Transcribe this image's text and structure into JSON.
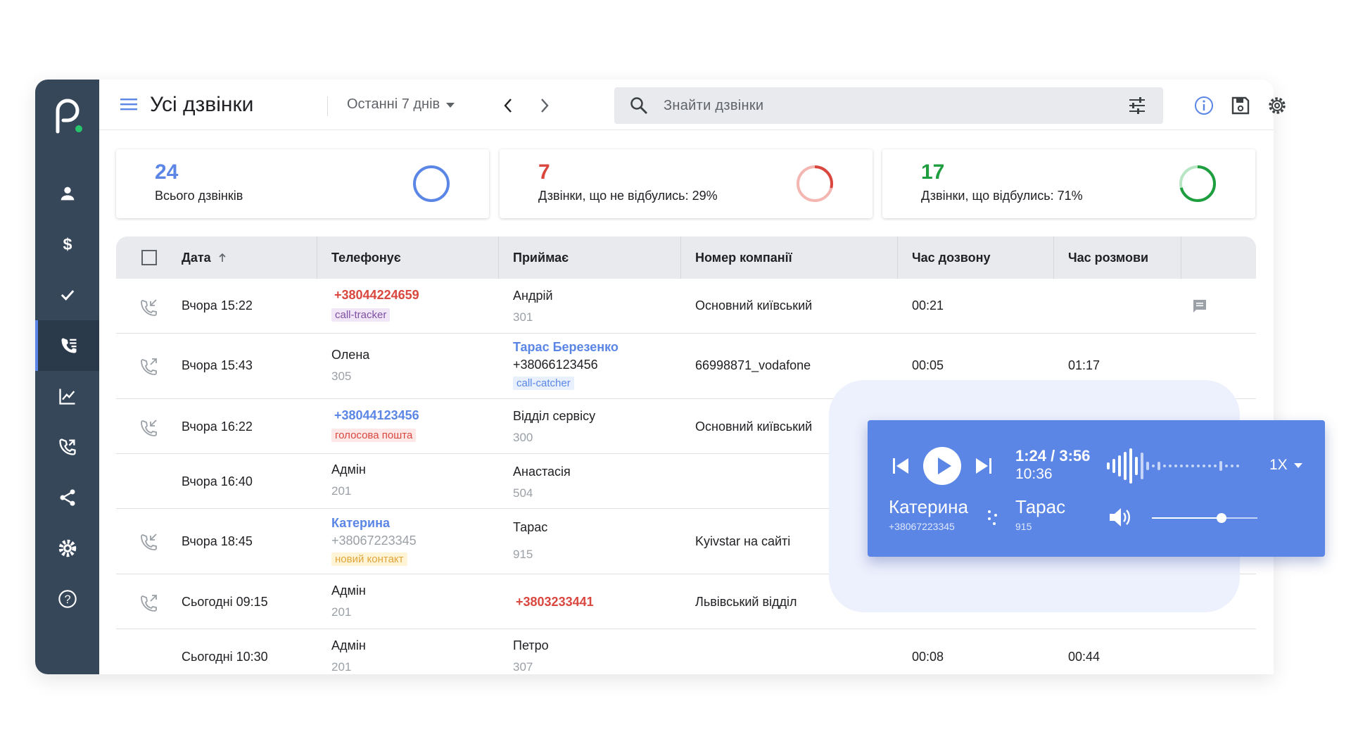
{
  "header": {
    "title": "Усі дзвінки",
    "period": "Останні 7 днів",
    "search_placeholder": "Знайти дзвінки"
  },
  "sidebar": {
    "items": [
      {
        "name": "users-icon"
      },
      {
        "name": "dollar-icon"
      },
      {
        "name": "check-icon"
      },
      {
        "name": "calls-list-icon",
        "active": true
      },
      {
        "name": "chart-icon"
      },
      {
        "name": "call-forward-icon"
      },
      {
        "name": "share-icon"
      },
      {
        "name": "settings-icon"
      },
      {
        "name": "help-icon"
      }
    ]
  },
  "stats": [
    {
      "value": "24",
      "label": "Всього дзвінків",
      "color": "#5b86e5",
      "ratio": 1.0
    },
    {
      "value": "7",
      "label": "Дзвінки, що не відбулись: 29%",
      "color": "#d9473e",
      "ratio": 0.29
    },
    {
      "value": "17",
      "label": "Дзвінки, що відбулись: 71%",
      "color": "#1e9e3f",
      "ratio": 0.71
    }
  ],
  "table": {
    "headers": {
      "date": "Дата",
      "caller": "Телефонує",
      "receiver": "Приймає",
      "company_number": "Номер компанії",
      "wait_time": "Час дозвону",
      "talk_time": "Час розмови"
    },
    "rows": [
      {
        "date": "Вчора 15:22",
        "caller": "+38044224659",
        "caller_tag": "call-tracker",
        "receiver": "Андрій",
        "receiver_sub": "301",
        "company": "Основний київський",
        "wait": "00:21",
        "talk": ""
      },
      {
        "date": "Вчора 15:43",
        "caller": "Олена",
        "caller_sub": "305",
        "receiver": "Тарас Березенко",
        "receiver_phone": "+38066123456",
        "receiver_tag": "call-catcher",
        "company": "66998871_vodafone",
        "wait": "00:05",
        "talk": "01:17"
      },
      {
        "date": "Вчора 16:22",
        "caller": "+38044123456",
        "caller_tag": "голосова пошта",
        "receiver": "Відділ сервісу",
        "receiver_sub": "300",
        "company": "Основний київський"
      },
      {
        "date": "Вчора 16:40",
        "caller": "Адмін",
        "caller_sub": "201",
        "receiver": "Анастасія",
        "receiver_sub": "504"
      },
      {
        "date": "Вчора 18:45",
        "caller": "Катерина",
        "caller_phone": "+38067223345",
        "caller_tag": "новий контакт",
        "receiver": "Тарас",
        "receiver_sub": "915",
        "company": "Kyivstar на сайті"
      },
      {
        "date": "Сьогодні 09:15",
        "caller": "Адмін",
        "caller_sub": "201",
        "receiver": "+3803233441",
        "company": "Львівський відділ"
      },
      {
        "date": "Сьогодні 10:30",
        "caller": "Адмін",
        "caller_sub": "201",
        "receiver": "Петро",
        "receiver_sub": "307",
        "wait": "00:08",
        "talk": "00:44"
      }
    ]
  },
  "player": {
    "position": "1:24 / 3:56",
    "time": "10:36",
    "speed": "1X",
    "from_name": "Катерина",
    "from_phone": "+38067223345",
    "to_name": "Тарас",
    "to_ext": "915",
    "volume": 0.66
  },
  "colors": {
    "sidebar": "#36475a",
    "accent": "#5b86e5",
    "red": "#d9473e",
    "green": "#1e9e3f"
  }
}
